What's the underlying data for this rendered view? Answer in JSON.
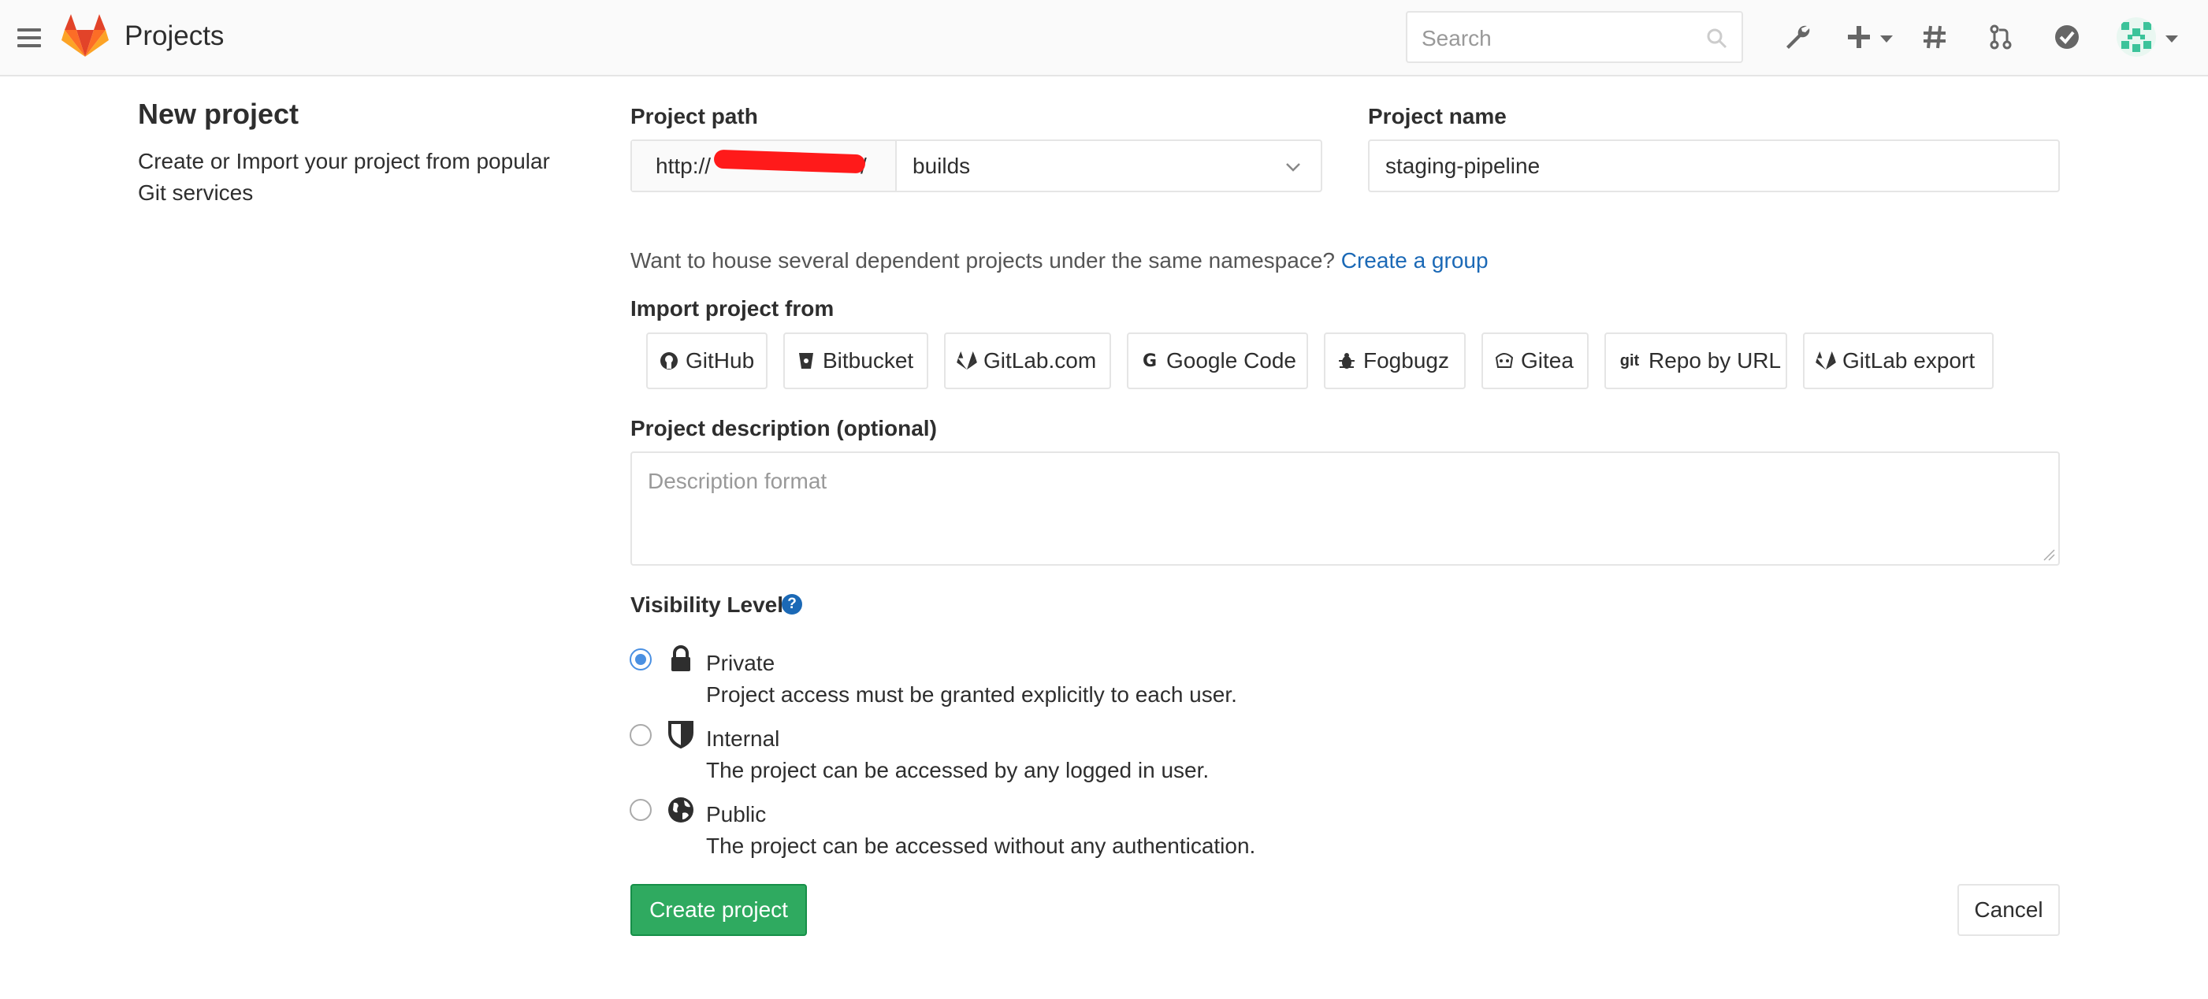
{
  "navbar": {
    "brand": "Projects",
    "search_placeholder": "Search",
    "icons": [
      "hamburger-icon",
      "gitlab-logo",
      "search-icon",
      "wrench-icon",
      "plus-icon",
      "hash-icon",
      "merge-request-icon",
      "todo-check-icon",
      "avatar"
    ]
  },
  "intro": {
    "title": "New project",
    "subtitle": "Create or Import your project from popular Git services"
  },
  "form": {
    "path_label": "Project path",
    "path_prefix": "http://",
    "path_suffix": "/",
    "namespace": "builds",
    "name_label": "Project name",
    "name_value": "staging-pipeline",
    "hint_text": "Want to house several dependent projects under the same namespace?",
    "hint_link": "Create a group",
    "import_label": "Import project from",
    "import_sources": [
      {
        "label": "GitHub",
        "icon": "github-icon"
      },
      {
        "label": "Bitbucket",
        "icon": "bitbucket-icon"
      },
      {
        "label": "GitLab.com",
        "icon": "gitlab-icon"
      },
      {
        "label": "Google Code",
        "icon": "google-icon"
      },
      {
        "label": "Fogbugz",
        "icon": "bug-icon"
      },
      {
        "label": "Gitea",
        "icon": "gitea-icon"
      },
      {
        "label": "Repo by URL",
        "icon": "git-icon"
      },
      {
        "label": "GitLab export",
        "icon": "gitlab-icon"
      }
    ],
    "description_label": "Project description (optional)",
    "description_placeholder": "Description format",
    "visibility_label": "Visibility Level",
    "visibility_options": [
      {
        "title": "Private",
        "desc": "Project access must be granted explicitly to each user.",
        "checked": true,
        "icon": "lock-icon"
      },
      {
        "title": "Internal",
        "desc": "The project can be accessed by any logged in user.",
        "checked": false,
        "icon": "shield-icon"
      },
      {
        "title": "Public",
        "desc": "The project can be accessed without any authentication.",
        "checked": false,
        "icon": "globe-icon"
      }
    ],
    "create_label": "Create project",
    "cancel_label": "Cancel"
  },
  "colors": {
    "accent_link": "#1b69b6",
    "create_green": "#2faa60",
    "radio_blue": "#4a90e2",
    "redaction": "#ff1a1a"
  }
}
